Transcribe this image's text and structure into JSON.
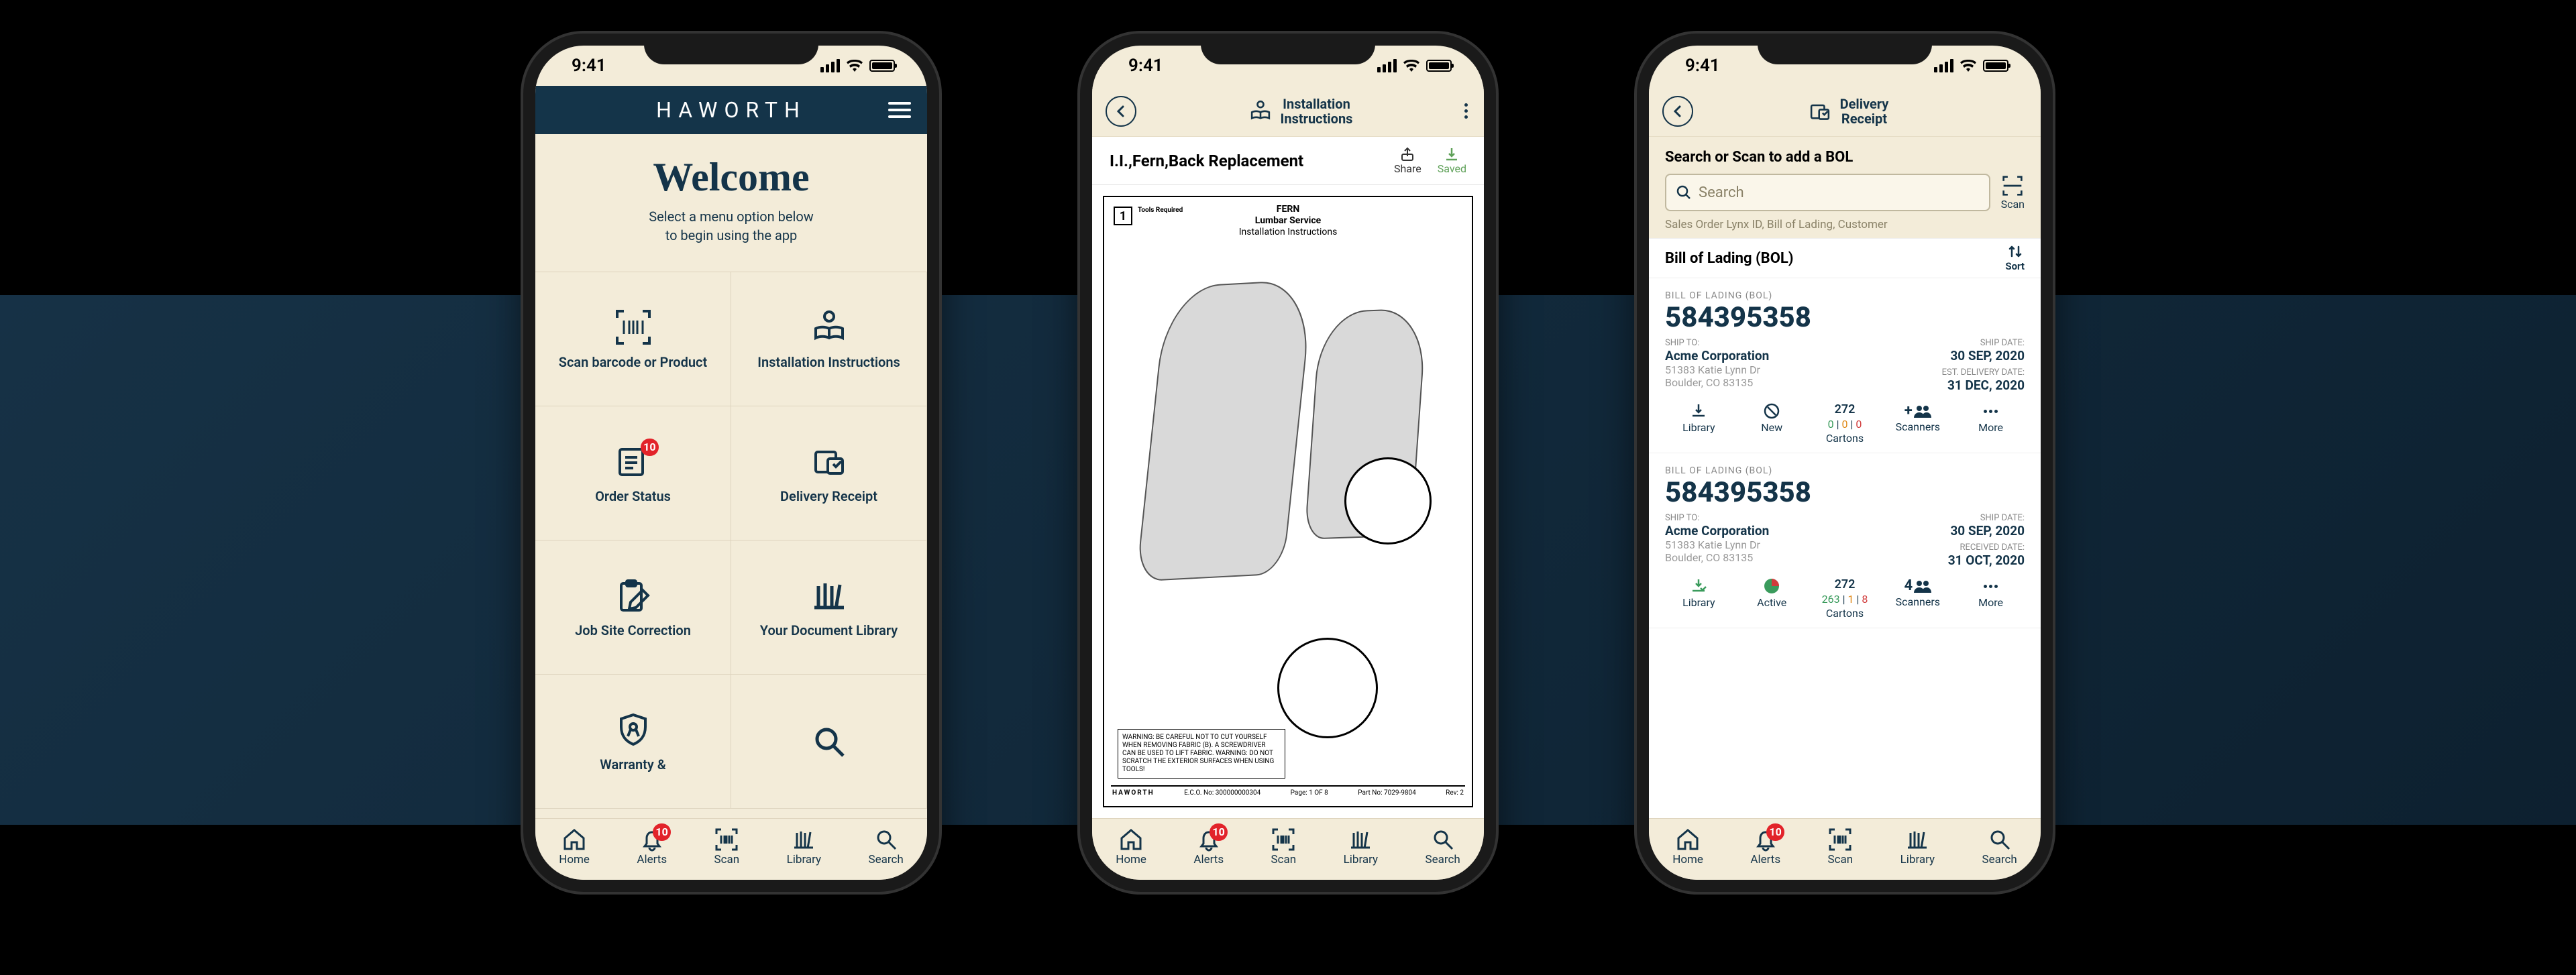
{
  "status": {
    "time": "9:41"
  },
  "phone1": {
    "brand": "HAWORTH",
    "welcome": {
      "title": "Welcome",
      "sub1": "Select a menu option below",
      "sub2": "to begin using the app"
    },
    "grid": {
      "scan": "Scan barcode or Product",
      "install": "Installation Instructions",
      "order": "Order Status",
      "order_badge": "10",
      "delivery": "Delivery Receipt",
      "jobsite": "Job Site Correction",
      "library": "Your Document Library",
      "warranty": "Warranty &"
    }
  },
  "nav": {
    "home": "Home",
    "alerts": "Alerts",
    "alerts_badge": "10",
    "scan": "Scan",
    "library": "Library",
    "search": "Search"
  },
  "phone2": {
    "header1": "Installation",
    "header2": "Instructions",
    "doc_title": "I.I.,Fern,Back Replacement",
    "share": "Share",
    "saved": "Saved",
    "doc_head1": "FERN",
    "doc_head2": "Lumbar Service",
    "doc_head3": "Installation Instructions",
    "tools_req": "Tools Required",
    "page_num": "1",
    "warning": "WARNING: BE CAREFUL NOT TO CUT YOURSELF WHEN REMOVING FABRIC (B). A SCREWDRIVER CAN BE USED TO LIFT FABRIC. WARNING: DO NOT SCRATCH THE EXTERIOR SURFACES WHEN USING TOOLS!",
    "foot_brand": "HAWORTH",
    "foot_ecc": "E.C.O. No: 300000000304",
    "foot_page": "Page: 1 OF 8",
    "foot_part": "Part No: 7029-9804",
    "foot_rev": "Rev: 2"
  },
  "phone3": {
    "header1": "Delivery",
    "header2": "Receipt",
    "search_hint": "Search or Scan to add a BOL",
    "search_placeholder": "Search",
    "scan_label": "Scan",
    "search_helper": "Sales Order Lynx ID, Bill of Lading, Customer",
    "section_title": "Bill of Lading (BOL)",
    "sort": "Sort",
    "tools": {
      "library": "Library",
      "new": "New",
      "active": "Active",
      "cartons": "Cartons",
      "scanners": "Scanners",
      "more": "More"
    },
    "cards": [
      {
        "eyebrow": "BILL OF LADING (BOL)",
        "number": "584395358",
        "ship_to_label": "SHIP TO:",
        "ship_to_name": "Acme Corporation",
        "addr1": "51383 Katie Lynn Dr",
        "addr2": "Boulder, CO 83135",
        "d1_label": "SHIP DATE:",
        "d1_value": "30 SEP,  2020",
        "d2_label": "EST. DELIVERY DATE:",
        "d2_value": "31 DEC, 2020",
        "cartons_top": "272",
        "cartons_sub": "0 | 0 | 0",
        "scanners": "+",
        "status_icon": "new"
      },
      {
        "eyebrow": "BILL OF LADING (BOL)",
        "number": "584395358",
        "ship_to_label": "SHIP TO:",
        "ship_to_name": "Acme Corporation",
        "addr1": "51383 Katie Lynn Dr",
        "addr2": "Boulder, CO 83135",
        "d1_label": "SHIP DATE:",
        "d1_value": "30 SEP,  2020",
        "d2_label": "RECEIVED DATE:",
        "d2_value": "31 OCT, 2020",
        "cartons_top": "272",
        "cartons_sub": "263 | 1 | 8",
        "scanners": "4",
        "status_icon": "active"
      }
    ]
  }
}
